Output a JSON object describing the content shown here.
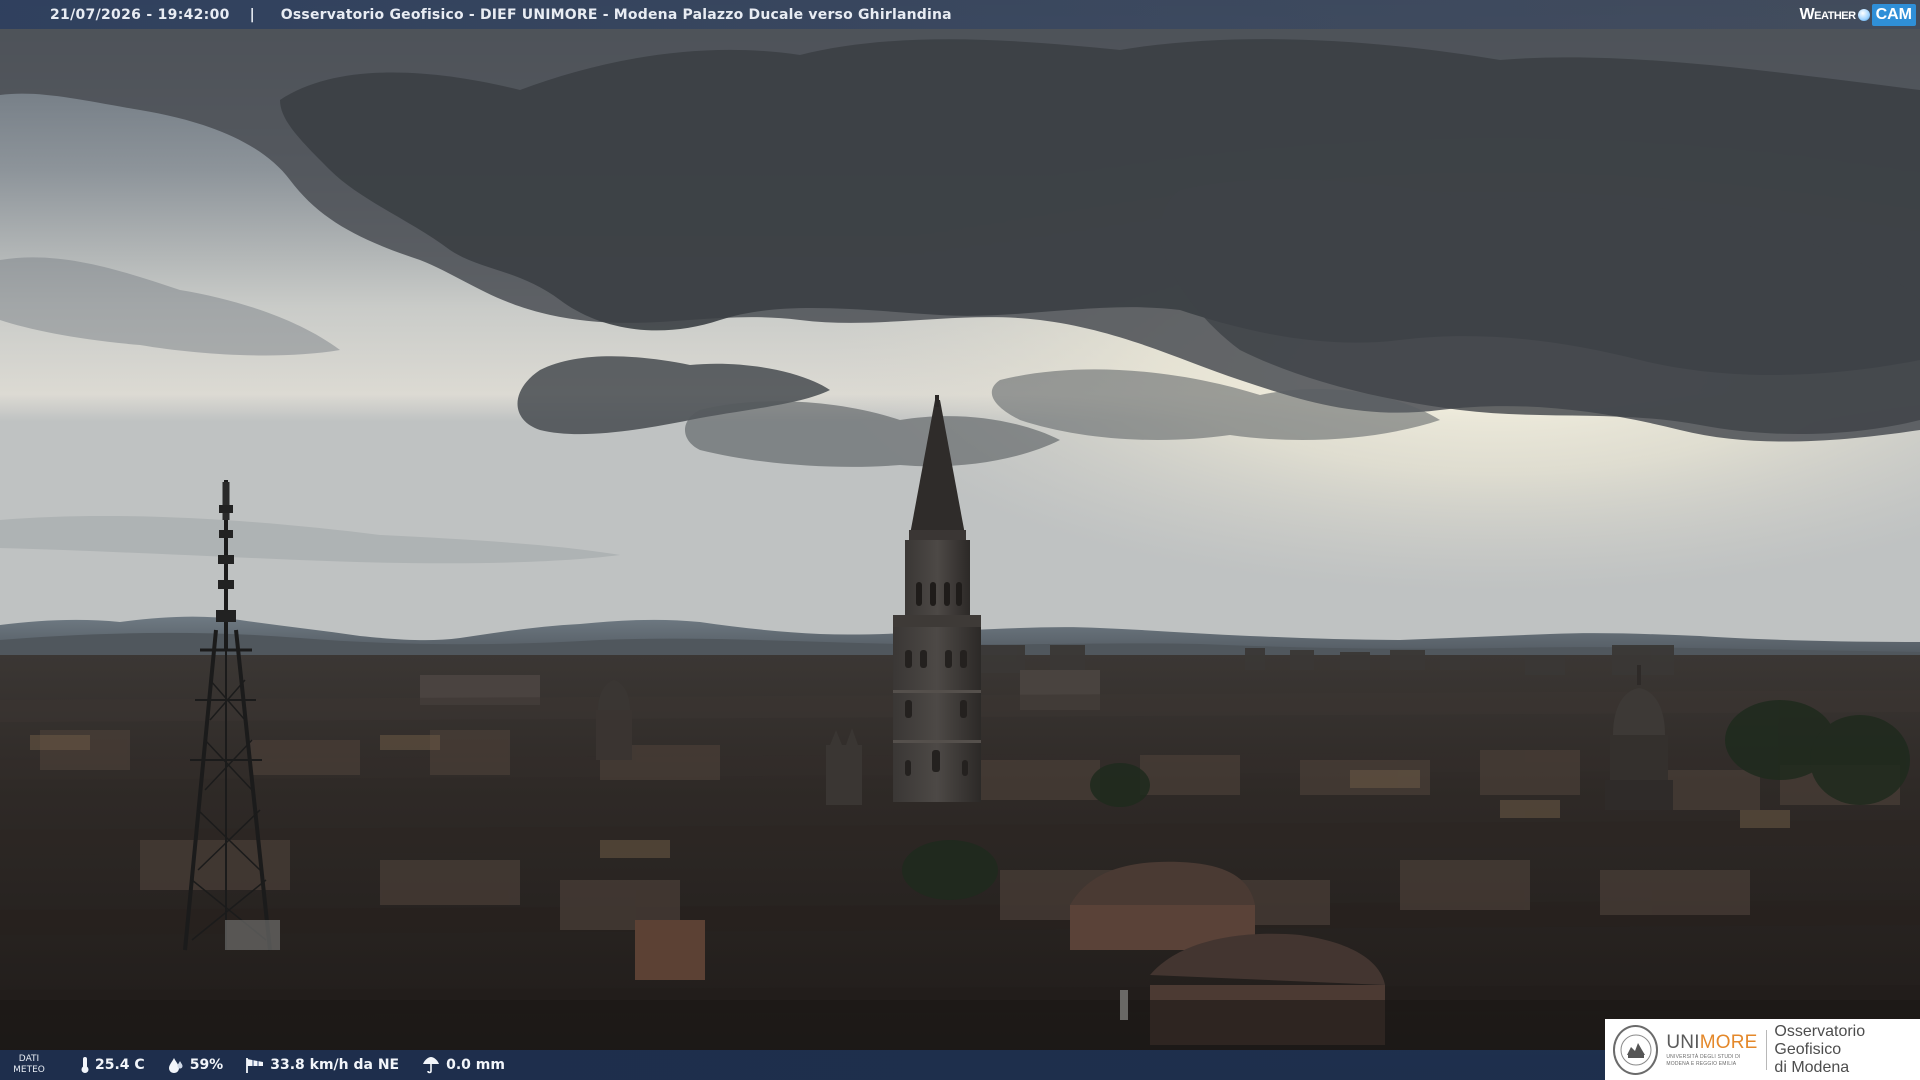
{
  "header": {
    "timestamp": "21/07/2026 - 19:42:00",
    "separator": "|",
    "camera_title": "Osservatorio Geofisico - DIEF UNIMORE - Modena Palazzo Ducale verso Ghirlandina"
  },
  "brand_logo": {
    "text_weather": "Weather",
    "text_cam": "CAM",
    "accent_color": "#2f8fd8"
  },
  "weather_bar": {
    "label_line1": "DATI",
    "label_line2": "METEO",
    "temperature": "25.4 C",
    "humidity": "59%",
    "wind": "33.8 km/h da NE",
    "rain": "0.0 mm",
    "icons": [
      "thermometer-icon",
      "humidity-drop-icon",
      "wind-sock-icon",
      "rain-gauge-icon"
    ]
  },
  "institution_logo": {
    "uni_part1": "UNI",
    "uni_part2": "MORE",
    "uni_subtitle_line1": "UNIVERSITÀ DEGLI STUDI DI",
    "uni_subtitle_line2": "MODENA E REGGIO EMILIA",
    "observatory_line1": "Osservatorio Geofisico",
    "observatory_line2": "di Modena",
    "uni_accent_color": "#e4882a"
  },
  "scene": {
    "description_colors": {
      "sky_light": "#e8e6df",
      "cloud_dark": "#3e4145",
      "rooftops": "#2a2523"
    }
  }
}
